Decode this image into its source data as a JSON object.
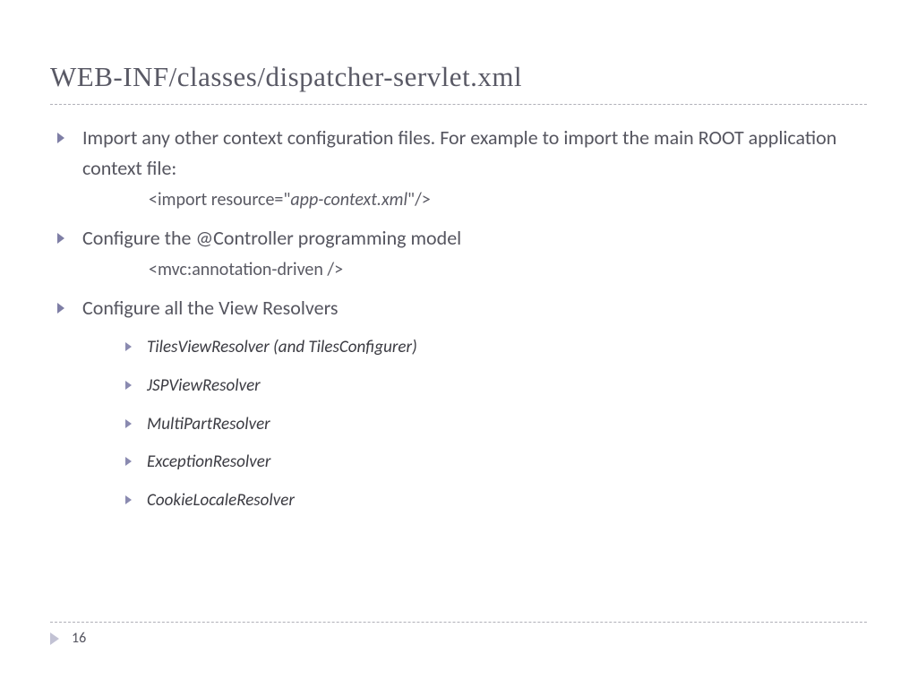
{
  "title": "WEB-INF/classes/dispatcher-servlet.xml",
  "bullets": [
    {
      "text": "Import any other context configuration files. For example to import the main ROOT application context file:",
      "code_prefix": "<import resource=\"",
      "code_italic": "app-context.xml",
      "code_suffix": "\"/>"
    },
    {
      "text": "Configure the @Controller programming model",
      "code_full": "<mvc:annotation-driven />"
    },
    {
      "text": "Configure all the View Resolvers",
      "sub": [
        "TilesViewResolver (and TilesConfigurer)",
        "JSPViewResolver",
        "MultiPartResolver",
        "ExceptionResolver",
        "CookieLocaleResolver"
      ]
    }
  ],
  "page_number": "16"
}
